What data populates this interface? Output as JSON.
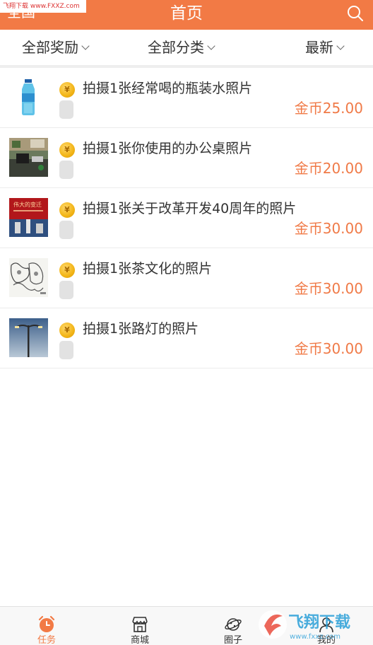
{
  "header": {
    "title": "首页",
    "region": "全国",
    "watermark": "飞翔下载 www.FXXZ.com"
  },
  "filters": [
    {
      "label": "全部奖励"
    },
    {
      "label": "全部分类"
    },
    {
      "label": "最新"
    }
  ],
  "tasks": [
    {
      "title": "拍摄1张经常喝的瓶装水照片",
      "reward": "金币25.00",
      "thumb": "water-bottle"
    },
    {
      "title": "拍摄1张你使用的办公桌照片",
      "reward": "金币20.00",
      "thumb": "office-desk"
    },
    {
      "title": "拍摄1张关于改革开发40周年的照片",
      "reward": "金币30.00",
      "thumb": "reform-anniversary",
      "thumb_text": "伟大的变迁"
    },
    {
      "title": "拍摄1张茶文化的照片",
      "reward": "金币30.00",
      "thumb": "tea-culture"
    },
    {
      "title": "拍摄1张路灯的照片",
      "reward": "金币30.00",
      "thumb": "street-lamp"
    }
  ],
  "tabs": [
    {
      "label": "任务",
      "icon": "alarm-clock-icon",
      "active": true
    },
    {
      "label": "商城",
      "icon": "store-icon",
      "active": false
    },
    {
      "label": "圈子",
      "icon": "planet-icon",
      "active": false
    },
    {
      "label": "我的",
      "icon": "user-icon",
      "active": false
    }
  ],
  "colors": {
    "accent": "#f27a45",
    "reward": "#f07a47"
  },
  "logo_text": "飞翔下载 www.fxxz.com"
}
